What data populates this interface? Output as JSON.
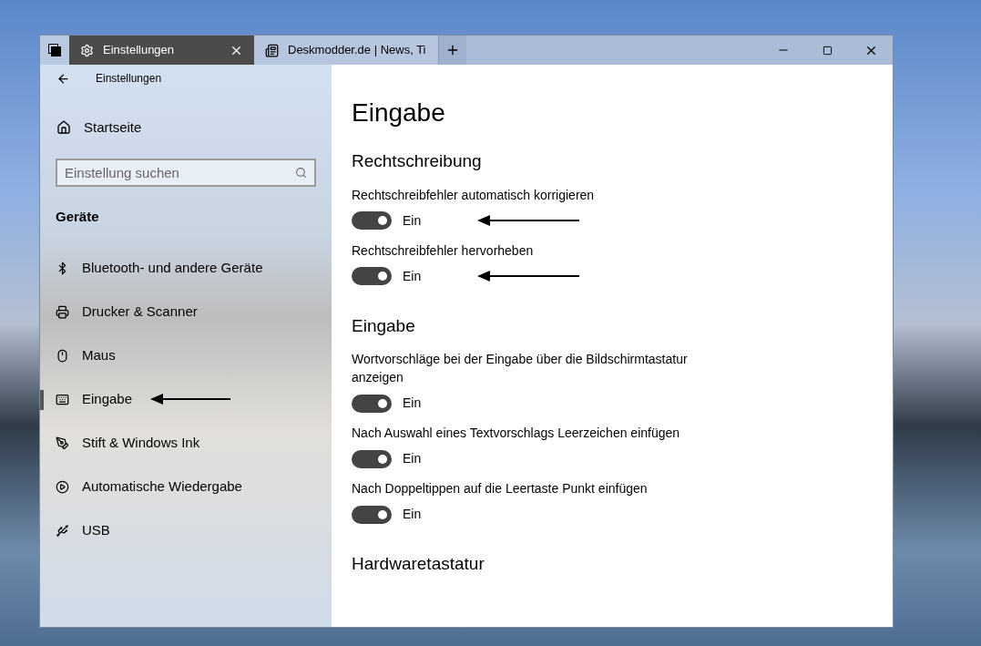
{
  "tabs": [
    {
      "title": "Einstellungen",
      "kind": "settings",
      "selected": true
    },
    {
      "title": "Deskmodder.de | News, Ti",
      "kind": "web",
      "selected": false
    }
  ],
  "header": {
    "title": "Einstellungen"
  },
  "sidebar": {
    "home": "Startseite",
    "search": {
      "placeholder": "Einstellung suchen"
    },
    "section": "Geräte",
    "items": [
      {
        "label": "Bluetooth- und andere Geräte",
        "kind": "bluetooth",
        "selected": false,
        "marked": false
      },
      {
        "label": "Drucker & Scanner",
        "kind": "printer",
        "selected": false,
        "marked": false
      },
      {
        "label": "Maus",
        "kind": "mouse",
        "selected": false,
        "marked": false
      },
      {
        "label": "Eingabe",
        "kind": "keyboard",
        "selected": true,
        "marked": true
      },
      {
        "label": "Stift & Windows Ink",
        "kind": "pen",
        "selected": false,
        "marked": false
      },
      {
        "label": "Automatische Wiedergabe",
        "kind": "autoplay",
        "selected": false,
        "marked": false
      },
      {
        "label": "USB",
        "kind": "usb",
        "selected": false,
        "marked": false
      }
    ]
  },
  "page": {
    "title": "Eingabe",
    "sections": [
      {
        "heading": "Rechtschreibung",
        "settings": [
          {
            "label": "Rechtschreibfehler automatisch korrigieren",
            "on": true,
            "state": "Ein",
            "marked": true
          },
          {
            "label": "Rechtschreibfehler hervorheben",
            "on": true,
            "state": "Ein",
            "marked": true
          }
        ]
      },
      {
        "heading": "Eingabe",
        "settings": [
          {
            "label": "Wortvorschläge bei der Eingabe über die Bildschirmtastatur anzeigen",
            "on": true,
            "state": "Ein",
            "marked": false
          },
          {
            "label": "Nach Auswahl eines Textvorschlags Leerzeichen einfügen",
            "on": true,
            "state": "Ein",
            "marked": false
          },
          {
            "label": "Nach Doppeltippen auf die Leertaste Punkt einfügen",
            "on": true,
            "state": "Ein",
            "marked": false
          }
        ]
      },
      {
        "heading": "Hardwaretastatur"
      }
    ]
  }
}
